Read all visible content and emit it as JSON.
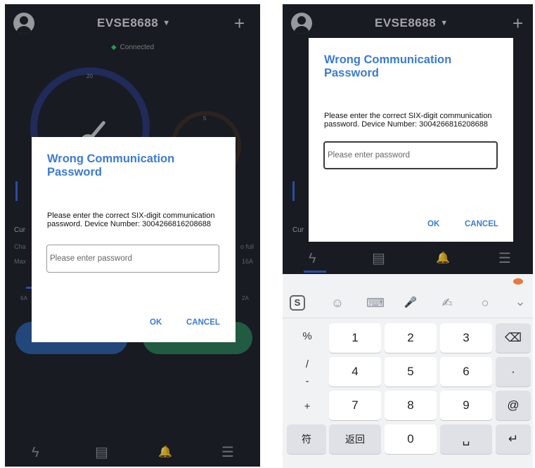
{
  "left": {
    "header": {
      "device_name": "EVSE8688",
      "caret": "▼",
      "add": "+",
      "status": "Connected",
      "wifi_glyph": "◆"
    },
    "gauge_big_ticks": [
      "20"
    ],
    "gauge_small_ticks": [
      "5"
    ],
    "fragments": {
      "cur": "Cur",
      "cha": "Cha",
      "max": "Max",
      "six_a": "6A",
      "full": "o full",
      "sixteen_a": "16A",
      "two_a": "2A"
    },
    "dialog": {
      "title": "Wrong Communication Password",
      "body": "Please enter the correct SIX-digit communication password. Device Number:  3004266816208688",
      "input_placeholder": "Please enter password",
      "ok": "OK",
      "cancel": "CANCEL"
    },
    "nav": [
      "ϟ",
      "▤",
      "🔔",
      "☰"
    ]
  },
  "right": {
    "header": {
      "device_name": "EVSE8688",
      "caret": "▼",
      "add": "+"
    },
    "fragments": {
      "cur": "Cur"
    },
    "dialog": {
      "title": "Wrong Communication Password",
      "body": "Please enter the correct SIX-digit communication password. Device Number:  3004266816208688",
      "input_placeholder": "Please enter password",
      "ok": "OK",
      "cancel": "CANCEL"
    },
    "nav": [
      "ϟ",
      "▤",
      "🔔",
      "☰"
    ],
    "keyboard": {
      "toolbar": [
        "S",
        "☺",
        "⌨",
        "🎤",
        "✍",
        "○",
        "⌄"
      ],
      "side_keys": [
        "%",
        "/",
        "-",
        "+"
      ],
      "row1": [
        "1",
        "2",
        "3"
      ],
      "row2": [
        "4",
        "5",
        "6"
      ],
      "row3": [
        "7",
        "8",
        "9"
      ],
      "right_col": [
        "⌫",
        "·",
        "@"
      ],
      "bottom": {
        "symbols": "符",
        "back": "返回",
        "zero": "0",
        "space": "␣",
        "enter": "↵"
      }
    }
  },
  "colors": {
    "accent": "#3a7bd5",
    "app_bg": "#20242c",
    "connected": "#3cc56e"
  }
}
